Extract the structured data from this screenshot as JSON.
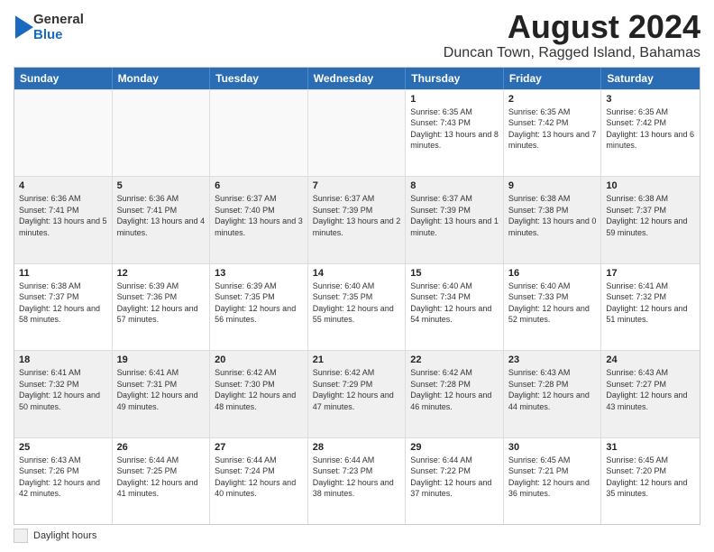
{
  "logo": {
    "general": "General",
    "blue": "Blue"
  },
  "title": "August 2024",
  "subtitle": "Duncan Town, Ragged Island, Bahamas",
  "days_of_week": [
    "Sunday",
    "Monday",
    "Tuesday",
    "Wednesday",
    "Thursday",
    "Friday",
    "Saturday"
  ],
  "footer_label": "Daylight hours",
  "weeks": [
    [
      {
        "day": "",
        "sunrise": "",
        "sunset": "",
        "daylight": "",
        "empty": true
      },
      {
        "day": "",
        "sunrise": "",
        "sunset": "",
        "daylight": "",
        "empty": true
      },
      {
        "day": "",
        "sunrise": "",
        "sunset": "",
        "daylight": "",
        "empty": true
      },
      {
        "day": "",
        "sunrise": "",
        "sunset": "",
        "daylight": "",
        "empty": true
      },
      {
        "day": "1",
        "sunrise": "Sunrise: 6:35 AM",
        "sunset": "Sunset: 7:43 PM",
        "daylight": "Daylight: 13 hours and 8 minutes."
      },
      {
        "day": "2",
        "sunrise": "Sunrise: 6:35 AM",
        "sunset": "Sunset: 7:42 PM",
        "daylight": "Daylight: 13 hours and 7 minutes."
      },
      {
        "day": "3",
        "sunrise": "Sunrise: 6:35 AM",
        "sunset": "Sunset: 7:42 PM",
        "daylight": "Daylight: 13 hours and 6 minutes."
      }
    ],
    [
      {
        "day": "4",
        "sunrise": "Sunrise: 6:36 AM",
        "sunset": "Sunset: 7:41 PM",
        "daylight": "Daylight: 13 hours and 5 minutes."
      },
      {
        "day": "5",
        "sunrise": "Sunrise: 6:36 AM",
        "sunset": "Sunset: 7:41 PM",
        "daylight": "Daylight: 13 hours and 4 minutes."
      },
      {
        "day": "6",
        "sunrise": "Sunrise: 6:37 AM",
        "sunset": "Sunset: 7:40 PM",
        "daylight": "Daylight: 13 hours and 3 minutes."
      },
      {
        "day": "7",
        "sunrise": "Sunrise: 6:37 AM",
        "sunset": "Sunset: 7:39 PM",
        "daylight": "Daylight: 13 hours and 2 minutes."
      },
      {
        "day": "8",
        "sunrise": "Sunrise: 6:37 AM",
        "sunset": "Sunset: 7:39 PM",
        "daylight": "Daylight: 13 hours and 1 minute."
      },
      {
        "day": "9",
        "sunrise": "Sunrise: 6:38 AM",
        "sunset": "Sunset: 7:38 PM",
        "daylight": "Daylight: 13 hours and 0 minutes."
      },
      {
        "day": "10",
        "sunrise": "Sunrise: 6:38 AM",
        "sunset": "Sunset: 7:37 PM",
        "daylight": "Daylight: 12 hours and 59 minutes."
      }
    ],
    [
      {
        "day": "11",
        "sunrise": "Sunrise: 6:38 AM",
        "sunset": "Sunset: 7:37 PM",
        "daylight": "Daylight: 12 hours and 58 minutes."
      },
      {
        "day": "12",
        "sunrise": "Sunrise: 6:39 AM",
        "sunset": "Sunset: 7:36 PM",
        "daylight": "Daylight: 12 hours and 57 minutes."
      },
      {
        "day": "13",
        "sunrise": "Sunrise: 6:39 AM",
        "sunset": "Sunset: 7:35 PM",
        "daylight": "Daylight: 12 hours and 56 minutes."
      },
      {
        "day": "14",
        "sunrise": "Sunrise: 6:40 AM",
        "sunset": "Sunset: 7:35 PM",
        "daylight": "Daylight: 12 hours and 55 minutes."
      },
      {
        "day": "15",
        "sunrise": "Sunrise: 6:40 AM",
        "sunset": "Sunset: 7:34 PM",
        "daylight": "Daylight: 12 hours and 54 minutes."
      },
      {
        "day": "16",
        "sunrise": "Sunrise: 6:40 AM",
        "sunset": "Sunset: 7:33 PM",
        "daylight": "Daylight: 12 hours and 52 minutes."
      },
      {
        "day": "17",
        "sunrise": "Sunrise: 6:41 AM",
        "sunset": "Sunset: 7:32 PM",
        "daylight": "Daylight: 12 hours and 51 minutes."
      }
    ],
    [
      {
        "day": "18",
        "sunrise": "Sunrise: 6:41 AM",
        "sunset": "Sunset: 7:32 PM",
        "daylight": "Daylight: 12 hours and 50 minutes."
      },
      {
        "day": "19",
        "sunrise": "Sunrise: 6:41 AM",
        "sunset": "Sunset: 7:31 PM",
        "daylight": "Daylight: 12 hours and 49 minutes."
      },
      {
        "day": "20",
        "sunrise": "Sunrise: 6:42 AM",
        "sunset": "Sunset: 7:30 PM",
        "daylight": "Daylight: 12 hours and 48 minutes."
      },
      {
        "day": "21",
        "sunrise": "Sunrise: 6:42 AM",
        "sunset": "Sunset: 7:29 PM",
        "daylight": "Daylight: 12 hours and 47 minutes."
      },
      {
        "day": "22",
        "sunrise": "Sunrise: 6:42 AM",
        "sunset": "Sunset: 7:28 PM",
        "daylight": "Daylight: 12 hours and 46 minutes."
      },
      {
        "day": "23",
        "sunrise": "Sunrise: 6:43 AM",
        "sunset": "Sunset: 7:28 PM",
        "daylight": "Daylight: 12 hours and 44 minutes."
      },
      {
        "day": "24",
        "sunrise": "Sunrise: 6:43 AM",
        "sunset": "Sunset: 7:27 PM",
        "daylight": "Daylight: 12 hours and 43 minutes."
      }
    ],
    [
      {
        "day": "25",
        "sunrise": "Sunrise: 6:43 AM",
        "sunset": "Sunset: 7:26 PM",
        "daylight": "Daylight: 12 hours and 42 minutes."
      },
      {
        "day": "26",
        "sunrise": "Sunrise: 6:44 AM",
        "sunset": "Sunset: 7:25 PM",
        "daylight": "Daylight: 12 hours and 41 minutes."
      },
      {
        "day": "27",
        "sunrise": "Sunrise: 6:44 AM",
        "sunset": "Sunset: 7:24 PM",
        "daylight": "Daylight: 12 hours and 40 minutes."
      },
      {
        "day": "28",
        "sunrise": "Sunrise: 6:44 AM",
        "sunset": "Sunset: 7:23 PM",
        "daylight": "Daylight: 12 hours and 38 minutes."
      },
      {
        "day": "29",
        "sunrise": "Sunrise: 6:44 AM",
        "sunset": "Sunset: 7:22 PM",
        "daylight": "Daylight: 12 hours and 37 minutes."
      },
      {
        "day": "30",
        "sunrise": "Sunrise: 6:45 AM",
        "sunset": "Sunset: 7:21 PM",
        "daylight": "Daylight: 12 hours and 36 minutes."
      },
      {
        "day": "31",
        "sunrise": "Sunrise: 6:45 AM",
        "sunset": "Sunset: 7:20 PM",
        "daylight": "Daylight: 12 hours and 35 minutes."
      }
    ]
  ]
}
